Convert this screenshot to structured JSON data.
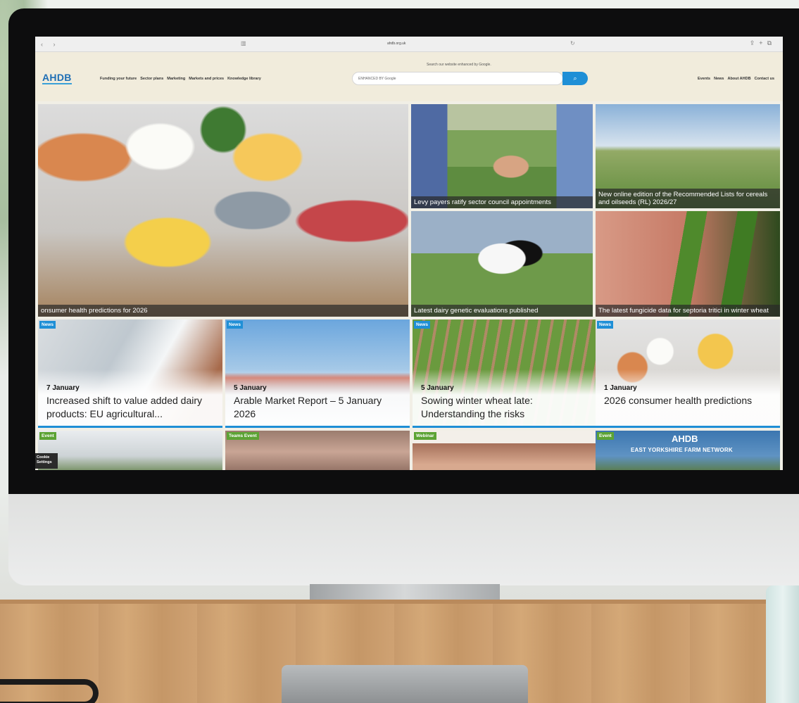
{
  "browser": {
    "url": "ahdb.org.uk"
  },
  "header": {
    "logo": "AHDB",
    "nav": [
      "Funding your future",
      "Sector plans",
      "Marketing",
      "Markets and prices",
      "Knowledge library"
    ],
    "search_hint": "Search our website enhanced by Google.",
    "search_placeholder": "ENHANCED BY Google",
    "right_nav": [
      "Events",
      "News",
      "About AHDB",
      "Contact us"
    ]
  },
  "hero": {
    "main_caption": "onsumer health predictions for 2026",
    "tiles": [
      {
        "caption": "Levy payers ratify sector council appointments"
      },
      {
        "caption": "New online edition of the Recommended Lists for cereals and oilseeds (RL) 2026/27"
      },
      {
        "caption": "Latest dairy genetic evaluations published"
      },
      {
        "caption": "The latest fungicide data for septoria tritici in winter wheat"
      }
    ]
  },
  "social": [
    "t",
    "f",
    "in",
    "🔗"
  ],
  "news": [
    {
      "badge": "News",
      "date": "7 January",
      "title": "Increased shift to value added dairy products: EU agricultural..."
    },
    {
      "badge": "News",
      "date": "5 January",
      "title": "Arable Market Report – 5 January 2026"
    },
    {
      "badge": "News",
      "date": "5 January",
      "title": "Sowing winter wheat late: Understanding the risks"
    },
    {
      "badge": "News",
      "date": "1 January",
      "title": "2026 consumer health predictions"
    }
  ],
  "events": [
    {
      "badge": "Event"
    },
    {
      "badge": "Teams Event"
    },
    {
      "badge": "Webinar"
    },
    {
      "badge": "Event",
      "logo": "AHDB",
      "title": "EAST YORKSHIRE FARM NETWORK"
    }
  ],
  "cookie": "Cookie Settings",
  "colors": {
    "brand_blue": "#1f8fd6",
    "event_green": "#5ca334",
    "header_bg": "#f1ecdc"
  }
}
